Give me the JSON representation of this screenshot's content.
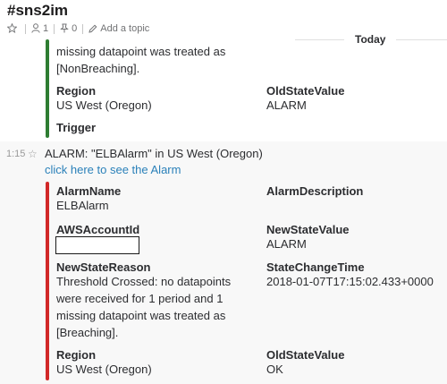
{
  "header": {
    "channel": "#sns2im",
    "members": "1",
    "pins": "0",
    "add_topic": "Add a topic"
  },
  "divider": {
    "label": "Today"
  },
  "msg1": {
    "reason_tail": [
      "missing datapoint was treated as",
      "[NonBreaching]."
    ],
    "region_label": "Region",
    "region_value": "US West (Oregon)",
    "old_state_label": "OldStateValue",
    "old_state_value": "ALARM",
    "trigger_label": "Trigger",
    "accent_color": "#2e7d32"
  },
  "msg2": {
    "time": "1:15",
    "title": "ALARM: \"ELBAlarm\" in US West (Oregon)",
    "link": "click here to see the Alarm",
    "accent_color": "#d22828",
    "fields": {
      "alarm_name_label": "AlarmName",
      "alarm_name_value": "ELBAlarm",
      "alarm_desc_label": "AlarmDescription",
      "account_label": "AWSAccountId",
      "new_state_label": "NewStateValue",
      "new_state_value": "ALARM",
      "reason_label": "NewStateReason",
      "reason_lines": [
        "Threshold Crossed: no datapoints",
        "were received for 1 period and 1",
        "missing datapoint was treated as",
        "[Breaching]."
      ],
      "change_time_label": "StateChangeTime",
      "change_time_value": "2018-01-07T17:15:02.433+0000",
      "region_label": "Region",
      "region_value": "US West (Oregon)",
      "old_state_label": "OldStateValue",
      "old_state_value": "OK"
    }
  }
}
